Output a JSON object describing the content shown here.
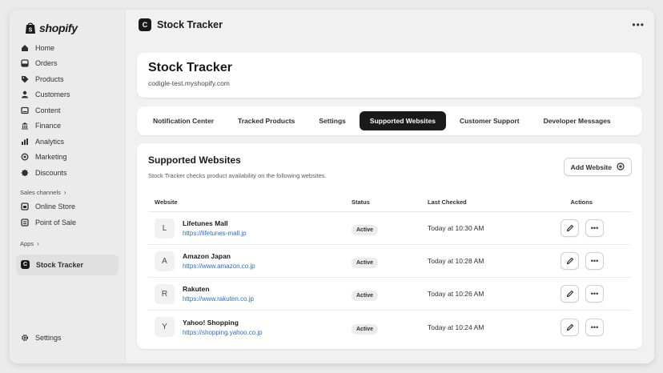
{
  "sidebar": {
    "brand": "shopify",
    "items": [
      {
        "label": "Home",
        "icon": "home-icon"
      },
      {
        "label": "Orders",
        "icon": "orders-icon"
      },
      {
        "label": "Products",
        "icon": "tag-icon"
      },
      {
        "label": "Customers",
        "icon": "person-icon"
      },
      {
        "label": "Content",
        "icon": "content-icon"
      },
      {
        "label": "Finance",
        "icon": "bank-icon"
      },
      {
        "label": "Analytics",
        "icon": "chart-icon"
      },
      {
        "label": "Marketing",
        "icon": "target-icon"
      },
      {
        "label": "Discounts",
        "icon": "discount-icon"
      }
    ],
    "sales_channels_label": "Sales channels",
    "channels": [
      {
        "label": "Online Store"
      },
      {
        "label": "Point of Sale"
      }
    ],
    "apps_label": "Apps",
    "active_app": "Stock Tracker",
    "settings_label": "Settings"
  },
  "topbar": {
    "title": "Stock Tracker",
    "badge": "C"
  },
  "header": {
    "title": "Stock Tracker",
    "domain": "codigle-test.myshopify.com"
  },
  "tabs": [
    {
      "label": "Notification Center"
    },
    {
      "label": "Tracked Products"
    },
    {
      "label": "Settings"
    },
    {
      "label": "Supported Websites"
    },
    {
      "label": "Customer Support"
    },
    {
      "label": "Developer Messages"
    }
  ],
  "main": {
    "title": "Supported Websites",
    "description": "Stock Tracker checks product availability on the following websites.",
    "add_button": "Add Website",
    "columns": {
      "website": "Website",
      "status": "Status",
      "last_checked": "Last Checked",
      "actions": "Actions"
    },
    "rows": [
      {
        "initial": "L",
        "name": "Lifetunes Mall",
        "url": "https://lifetunes-mall.jp",
        "status": "Active",
        "last_checked": "Today at 10:30 AM"
      },
      {
        "initial": "A",
        "name": "Amazon Japan",
        "url": "https://www.amazon.co.jp",
        "status": "Active",
        "last_checked": "Today at 10:28 AM"
      },
      {
        "initial": "R",
        "name": "Rakuten",
        "url": "https://www.rakuten.co.jp",
        "status": "Active",
        "last_checked": "Today at 10:26 AM"
      },
      {
        "initial": "Y",
        "name": "Yahoo! Shopping",
        "url": "https://shopping.yahoo.co.jp",
        "status": "Active",
        "last_checked": "Today at 10:24 AM"
      }
    ]
  }
}
